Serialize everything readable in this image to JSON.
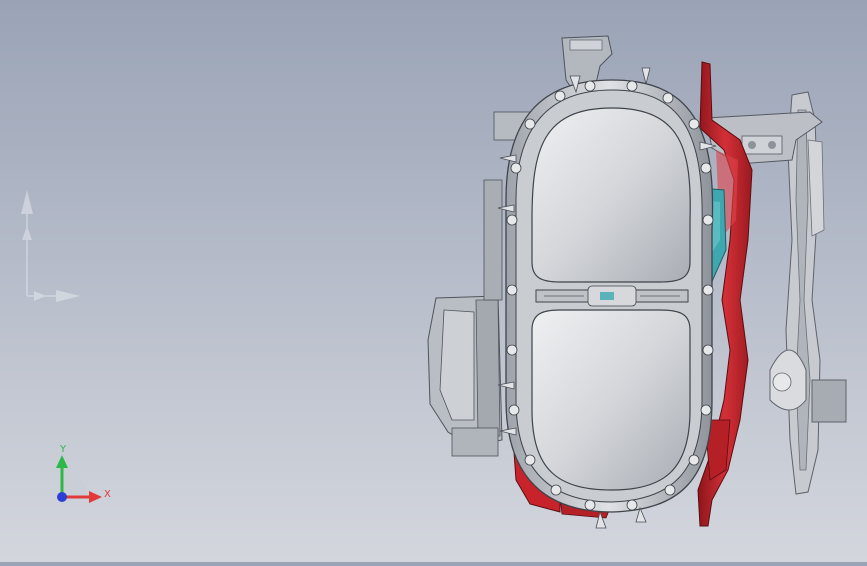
{
  "viewport": {
    "background_top": "#9aa3b6",
    "background_bottom": "#d3d6dd"
  },
  "triad": {
    "x_label": "X",
    "y_label": "Y",
    "x_color": "#e03a3a",
    "y_color": "#2fb84a",
    "z_color": "#2b3fd6"
  },
  "model": {
    "cover_color": "#d9d9dc",
    "red_part_color": "#c8232b",
    "teal_part_color": "#3fa7b0",
    "bracket_color": "#b8bcc4"
  },
  "icons": {
    "view_orientation": "view-orientation-icon",
    "triad": "reference-triad-icon"
  }
}
